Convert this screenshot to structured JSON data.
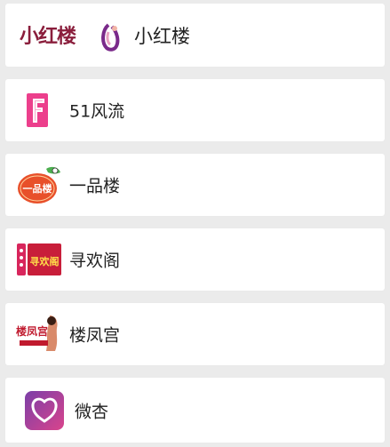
{
  "items": [
    {
      "label": "小红楼",
      "logo_text": "小红楼",
      "icon": "xiaohonglou-logo-icon",
      "accent": "#8a1e3c"
    },
    {
      "label": "51风流",
      "icon": "letter-f-logo-icon",
      "accent": "#ec3f8c"
    },
    {
      "label": "一品楼",
      "logo_text": "一品楼",
      "icon": "yipinlou-logo-icon",
      "accent": "#e8502a"
    },
    {
      "label": "寻欢阁",
      "logo_text": "寻欢阁",
      "icon": "xunhuange-logo-icon",
      "accent": "#c81e3a"
    },
    {
      "label": "楼凤宫",
      "logo_text": "楼凤宫",
      "icon": "loufenggong-logo-icon",
      "accent": "#c01a2e"
    },
    {
      "label": "微杏",
      "icon": "weixing-logo-icon",
      "accent": "#b0479e"
    }
  ]
}
